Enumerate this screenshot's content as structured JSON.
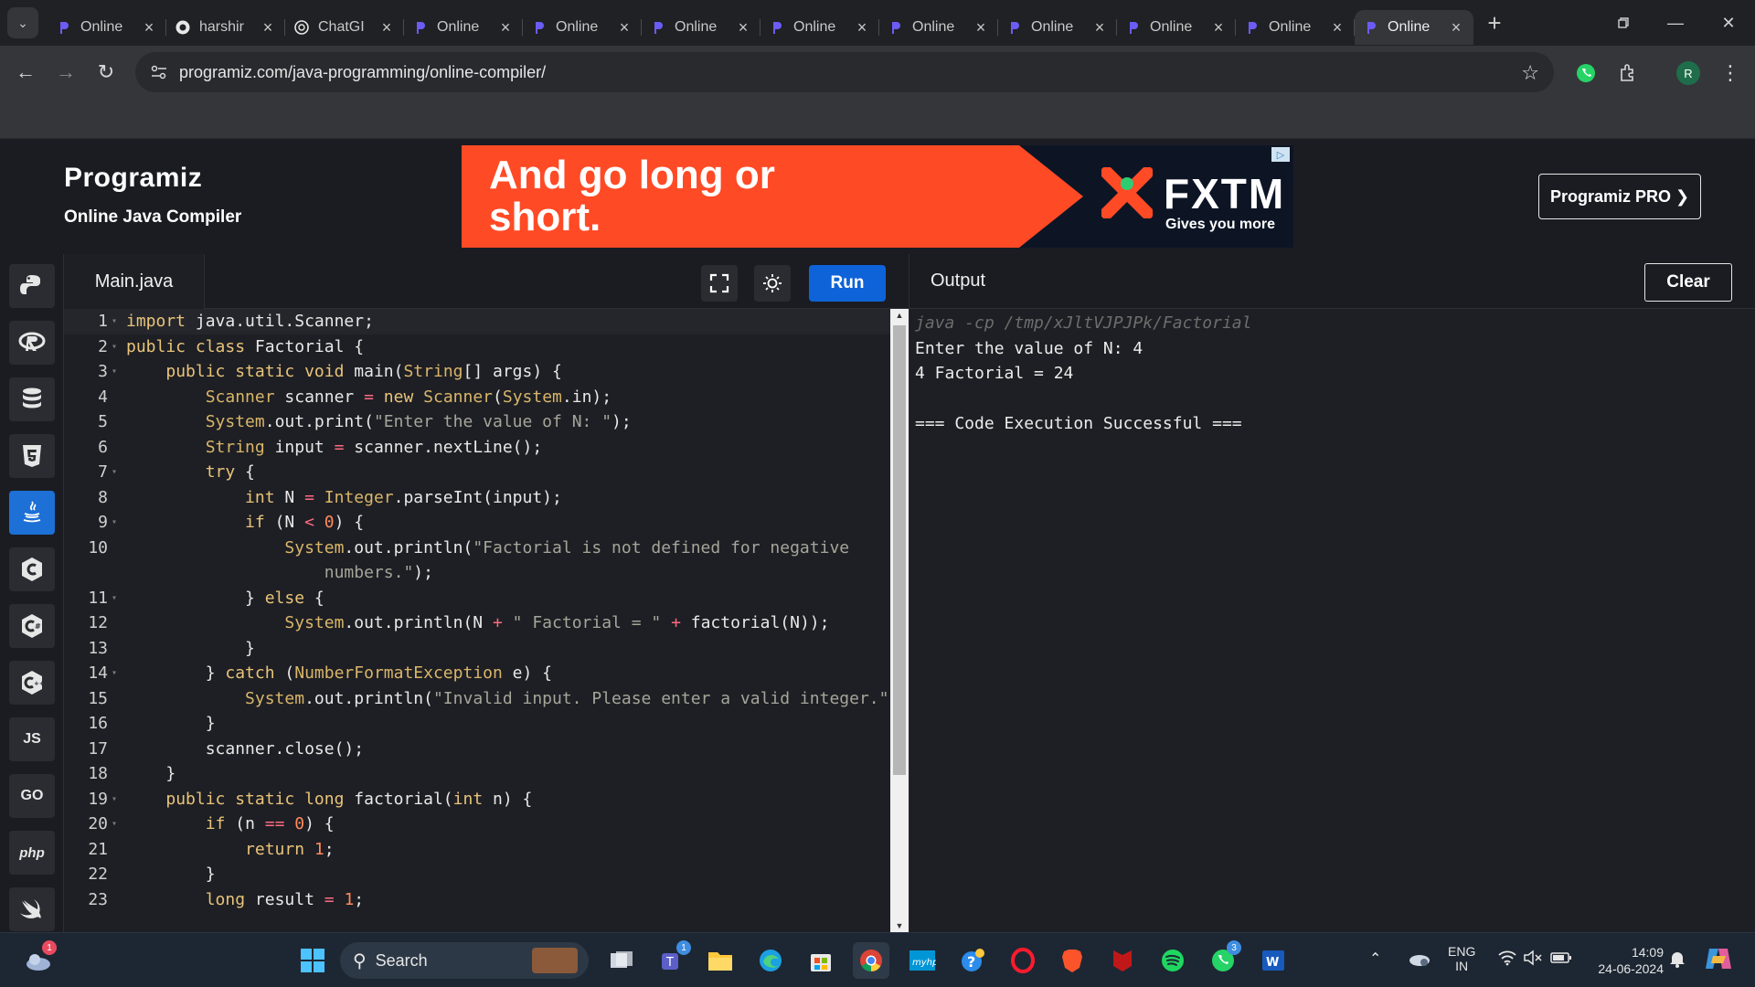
{
  "browser": {
    "tabs": [
      {
        "title": "Online",
        "icon": "programiz-icon"
      },
      {
        "title": "harshir",
        "icon": "github-icon"
      },
      {
        "title": "ChatGI",
        "icon": "chatgpt-icon"
      },
      {
        "title": "Online",
        "icon": "programiz-icon"
      },
      {
        "title": "Online",
        "icon": "programiz-icon"
      },
      {
        "title": "Online",
        "icon": "programiz-icon"
      },
      {
        "title": "Online",
        "icon": "programiz-icon"
      },
      {
        "title": "Online",
        "icon": "programiz-icon"
      },
      {
        "title": "Online",
        "icon": "programiz-icon"
      },
      {
        "title": "Online",
        "icon": "programiz-icon"
      },
      {
        "title": "Online",
        "icon": "programiz-icon"
      },
      {
        "title": "Online",
        "icon": "programiz-icon",
        "active": true
      }
    ],
    "url": "programiz.com/java-programming/online-compiler/",
    "profile_initial": "R"
  },
  "site": {
    "logo": "Programiz",
    "subtitle": "Online Java Compiler",
    "pro_button": "Programiz PRO ❯",
    "ad": {
      "headline": "And go long or short.",
      "brand": "FXTM",
      "tagline": "Gives you more"
    }
  },
  "languages": [
    {
      "name": "python-icon"
    },
    {
      "name": "r-icon"
    },
    {
      "name": "sql-icon"
    },
    {
      "name": "html5-icon"
    },
    {
      "name": "java-icon",
      "active": true
    },
    {
      "name": "c-icon"
    },
    {
      "name": "csharp-icon"
    },
    {
      "name": "cpp-icon"
    },
    {
      "name": "javascript-icon",
      "label": "JS"
    },
    {
      "name": "go-icon",
      "label": "GO"
    },
    {
      "name": "php-icon",
      "label": "php"
    },
    {
      "name": "swift-icon"
    }
  ],
  "editor": {
    "file_tab": "Main.java",
    "run_label": "Run",
    "code_lines": [
      {
        "n": "1",
        "fold": true,
        "html": "<span class=\"kw\">import</span> java.util.Scanner;"
      },
      {
        "n": "2",
        "fold": true,
        "html": "<span class=\"kw\">public class</span> Factorial {"
      },
      {
        "n": "3",
        "fold": true,
        "html": "    <span class=\"kw\">public static void</span> main(<span class=\"ty\">String</span>[] args) {"
      },
      {
        "n": "4",
        "html": "        <span class=\"ty\">Scanner</span> scanner <span class=\"op\">=</span> <span class=\"kw\">new</span> <span class=\"ty\">Scanner</span>(<span class=\"ty\">System</span>.in);"
      },
      {
        "n": "5",
        "html": "        <span class=\"ty\">System</span>.out.print(<span class=\"st\">\"Enter the value of N: \"</span>);"
      },
      {
        "n": "6",
        "html": "        <span class=\"ty\">String</span> input <span class=\"op\">=</span> scanner.nextLine();"
      },
      {
        "n": "7",
        "fold": true,
        "html": "        <span class=\"kw\">try</span> {"
      },
      {
        "n": "8",
        "html": "            <span class=\"kw\">int</span> N <span class=\"op\">=</span> <span class=\"ty\">Integer</span>.parseInt(input);"
      },
      {
        "n": "9",
        "fold": true,
        "html": "            <span class=\"kw\">if</span> (N <span class=\"op\">&lt;</span> <span class=\"nu\">0</span>) {"
      },
      {
        "n": "10",
        "html": "                <span class=\"ty\">System</span>.out.println(<span class=\"st\">\"Factorial is not defined for negative</span>"
      },
      {
        "n": "",
        "html": "                    <span class=\"st\">numbers.\"</span>);"
      },
      {
        "n": "11",
        "fold": true,
        "html": "            } <span class=\"kw\">else</span> {"
      },
      {
        "n": "12",
        "html": "                <span class=\"ty\">System</span>.out.println(N <span class=\"op\">+</span> <span class=\"st\">\" Factorial = \"</span> <span class=\"op\">+</span> factorial(N));"
      },
      {
        "n": "13",
        "html": "            }"
      },
      {
        "n": "14",
        "fold": true,
        "html": "        } <span class=\"kw\">catch</span> (<span class=\"ty\">NumberFormatException</span> e) {"
      },
      {
        "n": "15",
        "html": "            <span class=\"ty\">System</span>.out.println(<span class=\"st\">\"Invalid input. Please enter a valid integer.\"</span>);"
      },
      {
        "n": "16",
        "html": "        }"
      },
      {
        "n": "17",
        "html": "        scanner.close();"
      },
      {
        "n": "18",
        "html": "    }"
      },
      {
        "n": "19",
        "fold": true,
        "html": "    <span class=\"kw\">public static long</span> factorial(<span class=\"kw\">int</span> n) {"
      },
      {
        "n": "20",
        "fold": true,
        "html": "        <span class=\"kw\">if</span> (n <span class=\"op\">==</span> <span class=\"nu\">0</span>) {"
      },
      {
        "n": "21",
        "html": "            <span class=\"kw\">return</span> <span class=\"nu\">1</span>;"
      },
      {
        "n": "22",
        "html": "        }"
      },
      {
        "n": "23",
        "html": "        <span class=\"kw\">long</span> result <span class=\"op\">=</span> <span class=\"nu\">1</span>;"
      }
    ]
  },
  "output": {
    "title": "Output",
    "clear_label": "Clear",
    "lines": [
      {
        "text": "java -cp /tmp/xJltVJPJPk/Factorial",
        "cmd": true
      },
      {
        "text": "Enter the value of N: 4"
      },
      {
        "text": "4 Factorial = 24"
      },
      {
        "text": ""
      },
      {
        "text": "=== Code Execution Successful ==="
      }
    ]
  },
  "taskbar": {
    "search_label": "Search",
    "weather_badge": "1",
    "teams_badge": "1",
    "whatsapp_badge": "3",
    "lang_top": "ENG",
    "lang_bottom": "IN",
    "time": "14:09",
    "date": "24-06-2024"
  }
}
